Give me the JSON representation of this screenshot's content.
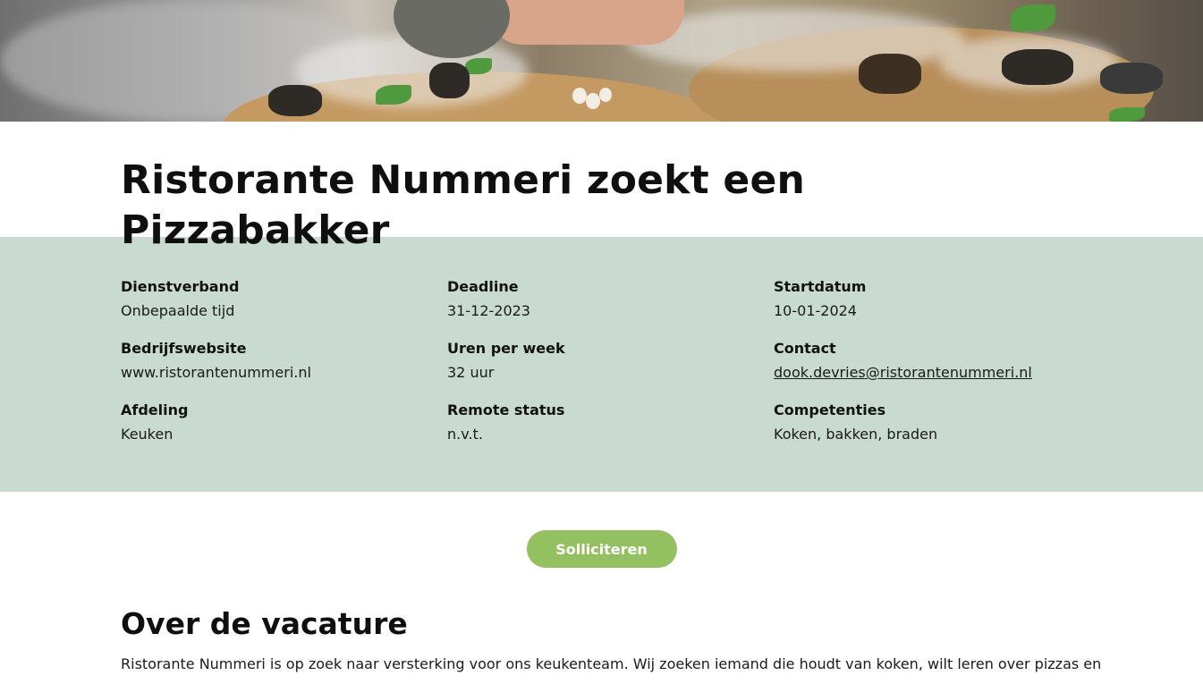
{
  "hero": {
    "image_alt": "sfeerfoto gerechten"
  },
  "page": {
    "title": "Ristorante Nummeri zoekt een Pizzabakker"
  },
  "details": [
    {
      "label": "Dienstverband",
      "value": "Onbepaalde tijd"
    },
    {
      "label": "Deadline",
      "value": "31-12-2023"
    },
    {
      "label": "Startdatum",
      "value": "10-01-2024"
    },
    {
      "label": "Bedrijfswebsite",
      "value": "www.ristorantenummeri.nl"
    },
    {
      "label": "Uren per week",
      "value": "32 uur"
    },
    {
      "label": "Contact",
      "value": "dook.devries@ristorantenummeri.nl"
    },
    {
      "label": "Afdeling",
      "value": "Keuken"
    },
    {
      "label": "Remote status",
      "value": "n.v.t."
    },
    {
      "label": "Competenties",
      "value": "Koken, bakken, braden"
    }
  ],
  "cta": {
    "label": "Solliciteren"
  },
  "about": {
    "heading": "Over de vacature",
    "intro": "Ristorante Nummeri is op zoek naar versterking voor ons keukenteam. Wij zoeken iemand die houdt van koken, wilt leren over pizzas en"
  },
  "colors": {
    "band": "#c9dbd0",
    "button": "#93c15f"
  }
}
